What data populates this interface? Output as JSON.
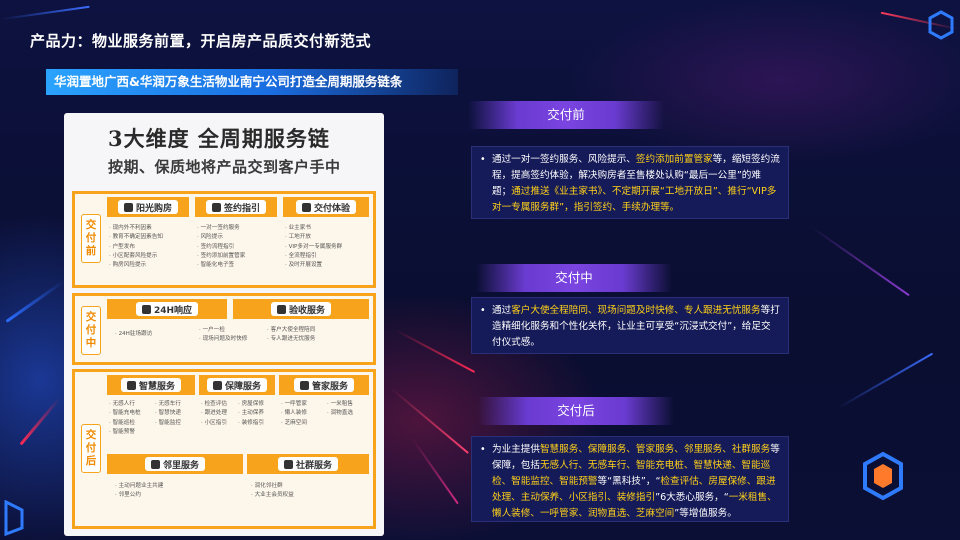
{
  "page": {
    "title": "产品力：物业服务前置，开启房产品质交付新范式",
    "subtitle": "华润置地广西&华润万象生活物业南宁公司打造全周期服务链条"
  },
  "doc": {
    "h1": "3大维度 全周期服务链",
    "h2": "按期、保质地将产品交到客户手中",
    "stages": [
      {
        "label": "交付前",
        "cols": [
          {
            "title": "阳光购房",
            "items": [
              "现内外不利因素",
              "教育不确定因素告知",
              "户型发布",
              "小区配套风险提示",
              "购房风险提示"
            ]
          },
          {
            "title": "签约指引",
            "items": [
              "一对一签约服务",
              "风险提示",
              "签约流程指引",
              "签约添加前置管家",
              "智能化电子签"
            ]
          },
          {
            "title": "交付体验",
            "items": [
              "业主家书",
              "工地开放",
              "VIP多对一专属服务群",
              "全流程指引",
              "及时开展设置"
            ]
          }
        ]
      },
      {
        "label": "交付中",
        "cols": [
          {
            "title": "24H响应",
            "items": [
              "24H驻场跟访"
            ]
          },
          {
            "title": "验收服务",
            "items": [
              "一户一检",
              "现场问题及时快修",
              "客户大使全程陪同",
              "专人跟进无忧服务"
            ]
          }
        ]
      },
      {
        "label": "交付后",
        "cols": [
          {
            "title": "智慧服务",
            "items": [
              "无感人行",
              "无感车行",
              "智能充电桩",
              "智慧快递",
              "智能巡检",
              "智能监控",
              "智能预警"
            ]
          },
          {
            "title": "保障服务",
            "items": [
              "检查评估",
              "房屋保修",
              "跟进处理",
              "主动保养",
              "小区指引",
              "装修指引"
            ]
          },
          {
            "title": "管家服务",
            "items": [
              "一呼管家",
              "一米租售",
              "懒人装修",
              "润物直选",
              "芝麻空间"
            ]
          },
          {
            "title": "邻里服务",
            "items": [
              "主动问题业主共建",
              "邻里公约"
            ]
          },
          {
            "title": "社群服务",
            "items": [
              "润化邻社群",
              "大业主会员权益"
            ]
          }
        ]
      }
    ]
  },
  "right": {
    "before": {
      "heading": "交付前",
      "bullet": "•",
      "segments": [
        {
          "t": "通过一对一签约服务、风险提示、",
          "h": false
        },
        {
          "t": "签约添加前置管家",
          "h": true
        },
        {
          "t": "等，缩短签约流程，提高签约体验，解决购房者至售楼处认购“最后一公里”的难题；",
          "h": false
        },
        {
          "t": "通过推送《业主家书》、不定期开展“工地开放日”、推行“VIP多对一专属服务群”，指引签约、手续办理等。",
          "h": true
        }
      ]
    },
    "during": {
      "heading": "交付中",
      "bullet": "•",
      "segments": [
        {
          "t": "通过",
          "h": false
        },
        {
          "t": "客户大使全程陪同、现场问题及时快修、专人跟进无忧服务",
          "h": true
        },
        {
          "t": "等打造精细化服务和个性化关怀，让业主可享受“沉浸式交付”，给足交付仪式感。",
          "h": false
        }
      ]
    },
    "after": {
      "heading": "交付后",
      "bullet": "•",
      "segments": [
        {
          "t": "为业主提供",
          "h": false
        },
        {
          "t": "智慧服务、保障服务、管家服务、邻里服务、社群服务",
          "h": true
        },
        {
          "t": "等保障，包括",
          "h": false
        },
        {
          "t": "无感人行、无感车行、智能充电桩、智慧快递、智能巡检、智能监控、智能预警",
          "h": true
        },
        {
          "t": "等“黑科技”，“",
          "h": false
        },
        {
          "t": "检查评估、房屋保修、跟进处理、主动保养、小区指引、装修指引",
          "h": true
        },
        {
          "t": "”6大悉心服务，“",
          "h": false
        },
        {
          "t": "一米租售、懒人装修、一呼管家、润物直选、芝麻空间",
          "h": true
        },
        {
          "t": "”等增值服务。",
          "h": false
        }
      ]
    }
  },
  "colors": {
    "accent_orange": "#f7a31c",
    "highlight_yellow": "#ffd21a",
    "heading_purple": "#7a44e0"
  }
}
